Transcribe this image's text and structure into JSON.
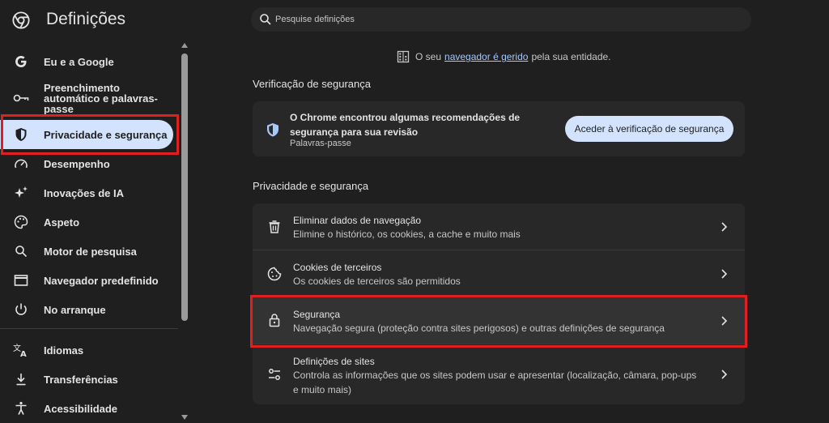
{
  "header": {
    "title": "Definições",
    "logo_icon": "chrome-logo-icon"
  },
  "search": {
    "placeholder": "Pesquise definições",
    "value": ""
  },
  "sidebar": {
    "items": [
      {
        "label": "Eu e a Google",
        "icon": "google-g-icon"
      },
      {
        "label": "Preenchimento automático e palavras-passe",
        "icon": "key-icon"
      },
      {
        "label": "Privacidade e segurança",
        "icon": "shield-icon",
        "active": true
      },
      {
        "label": "Desempenho",
        "icon": "speedometer-icon"
      },
      {
        "label": "Inovações de IA",
        "icon": "sparkle-icon"
      },
      {
        "label": "Aspeto",
        "icon": "palette-icon"
      },
      {
        "label": "Motor de pesquisa",
        "icon": "search-icon"
      },
      {
        "label": "Navegador predefinido",
        "icon": "browser-window-icon"
      },
      {
        "label": "No arranque",
        "icon": "power-icon"
      },
      {
        "label": "Idiomas",
        "icon": "translate-icon"
      },
      {
        "label": "Transferências",
        "icon": "download-icon"
      },
      {
        "label": "Acessibilidade",
        "icon": "accessibility-icon"
      }
    ]
  },
  "managed": {
    "prefix": "O seu",
    "link": "navegador é gerido",
    "suffix": "pela sua entidade.",
    "icon": "building-icon"
  },
  "safety_check": {
    "section_title": "Verificação de segurança",
    "title": "O Chrome encontrou algumas recomendações de segurança para sua revisão",
    "subtitle": "Palavras-passe",
    "button": "Aceder à verificação de segurança"
  },
  "privacy": {
    "section_title": "Privacidade e segurança",
    "rows": [
      {
        "title": "Eliminar dados de navegação",
        "subtitle": "Elimine o histórico, os cookies, a cache e muito mais",
        "icon": "trash-icon"
      },
      {
        "title": "Cookies de terceiros",
        "subtitle": "Os cookies de terceiros são permitidos",
        "icon": "cookie-icon"
      },
      {
        "title": "Segurança",
        "subtitle": "Navegação segura (proteção contra sites perigosos) e outras definições de segurança",
        "icon": "lock-icon"
      },
      {
        "title": "Definições de sites",
        "subtitle": "Controla as informações que os sites podem usar e apresentar (localização, câmara, pop-ups e muito mais)",
        "icon": "tune-icon"
      }
    ]
  },
  "colors": {
    "background": "#1f1f1f",
    "card": "#282828",
    "accent": "#d3e3fd",
    "link": "#a8c7fa",
    "highlight_outline": "#e02020"
  }
}
